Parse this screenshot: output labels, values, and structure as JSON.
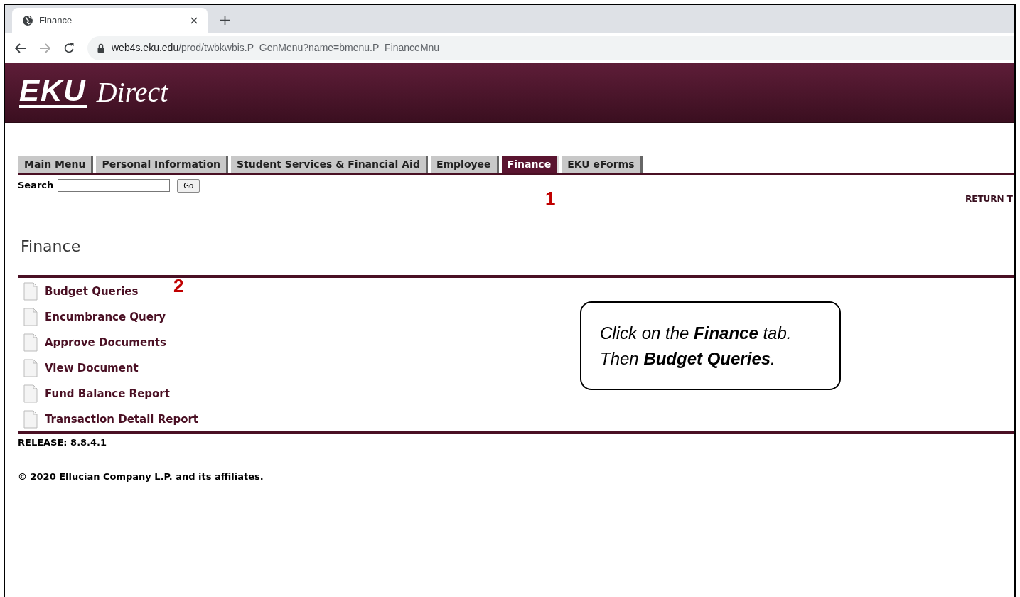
{
  "browser": {
    "tab_title": "Finance",
    "url_host": "web4s.eku.edu",
    "url_path": "/prod/twbkwbis.P_GenMenu?name=bmenu.P_FinanceMnu"
  },
  "banner": {
    "logo_mark": "EKU",
    "logo_text": "Direct"
  },
  "tabs": [
    {
      "label": "Main Menu",
      "selected": false
    },
    {
      "label": "Personal Information",
      "selected": false
    },
    {
      "label": "Student Services & Financial Aid",
      "selected": false
    },
    {
      "label": "Employee",
      "selected": false
    },
    {
      "label": "Finance",
      "selected": true
    },
    {
      "label": "EKU eForms",
      "selected": false
    }
  ],
  "search": {
    "label": "Search",
    "button": "Go"
  },
  "return_link": "RETURN T",
  "page_title": "Finance",
  "menu_items": [
    "Budget Queries",
    "Encumbrance Query",
    "Approve Documents",
    "View Document",
    "Fund Balance Report",
    "Transaction Detail Report"
  ],
  "release": "RELEASE: 8.8.4.1",
  "copyright": "© 2020 Ellucian Company L.P. and its affiliates.",
  "annotations": {
    "step_1": "1",
    "step_2": "2"
  },
  "callout": [
    "Click on the **Finance** tab.",
    "Then **Budget Queries**."
  ]
}
